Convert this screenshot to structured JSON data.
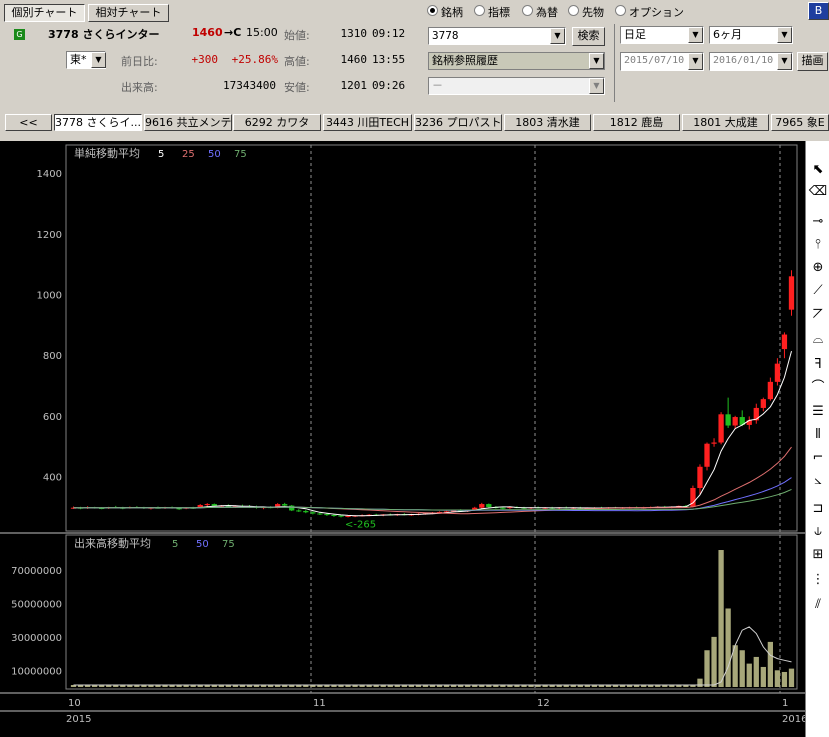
{
  "tabs_top": {
    "individual": "個別チャート",
    "relative": "相対チャート"
  },
  "stock": {
    "badge": "G",
    "code_name": "3778 さくらインター",
    "price": "1460",
    "arrow": "→C",
    "time": "15:00",
    "market": "東*",
    "change_label": "前日比:",
    "change": "+300",
    "change_pct": "+25.86%",
    "volume_label": "出来高:",
    "volume": "17343400"
  },
  "ohlc": {
    "open_label": "始値:",
    "open": "1310",
    "open_time": "09:12",
    "high_label": "高値:",
    "high": "1460",
    "high_time": "13:55",
    "low_label": "安値:",
    "low": "1201",
    "low_time": "09:26"
  },
  "radios": [
    "銘柄",
    "指標",
    "為替",
    "先物",
    "オプション"
  ],
  "radio_selected": "銘柄",
  "search": {
    "value": "3778",
    "button": "検索",
    "history": "銘柄参照履歴",
    "sub": "－"
  },
  "period": {
    "interval": "日足",
    "span": "6ヶ月",
    "from": "2015/07/10",
    "to": "2016/01/10",
    "draw": "描画"
  },
  "corner_btn": "B",
  "scroll_left": "<<",
  "stock_tabs": [
    "3778 さくらイ...",
    "9616 共立メンテ",
    "6292 カワタ",
    "3443 川田TECH",
    "3236 プロパスト",
    "1803 清水建",
    "1812 鹿島",
    "1801 大成建",
    "7965 象E"
  ],
  "chart_data": [
    {
      "type": "candlestick",
      "title": "単純移動平均",
      "ma_periods": [
        "5",
        "25",
        "50",
        "75"
      ],
      "ma_colors": [
        "#ffffff",
        "#e07070",
        "#7070ff",
        "#6fae6f"
      ],
      "y_ticks": [
        1400,
        1200,
        1000,
        800,
        600,
        400
      ],
      "ylim": [
        240,
        1460
      ],
      "annotation": "<-265",
      "annotation_value": 265,
      "candles": [
        [
          297,
          301,
          293,
          297
        ],
        [
          297,
          300,
          292,
          296
        ],
        [
          296,
          302,
          293,
          298
        ],
        [
          298,
          300,
          294,
          296
        ],
        [
          296,
          299,
          292,
          295
        ],
        [
          295,
          300,
          293,
          299
        ],
        [
          299,
          303,
          295,
          297
        ],
        [
          297,
          300,
          292,
          296
        ],
        [
          296,
          301,
          294,
          299
        ],
        [
          299,
          302,
          296,
          298
        ],
        [
          298,
          300,
          293,
          295
        ],
        [
          295,
          299,
          291,
          297
        ],
        [
          297,
          301,
          294,
          296
        ],
        [
          296,
          300,
          293,
          298
        ],
        [
          298,
          301,
          294,
          295
        ],
        [
          295,
          298,
          290,
          294
        ],
        [
          294,
          299,
          292,
          297
        ],
        [
          297,
          300,
          293,
          296
        ],
        [
          296,
          309,
          295,
          306
        ],
        [
          306,
          312,
          301,
          309
        ],
        [
          309,
          311,
          300,
          302
        ],
        [
          302,
          306,
          297,
          304
        ],
        [
          304,
          308,
          298,
          300
        ],
        [
          300,
          305,
          296,
          303
        ],
        [
          303,
          307,
          298,
          301
        ],
        [
          301,
          306,
          296,
          300
        ],
        [
          300,
          304,
          294,
          297
        ],
        [
          297,
          301,
          292,
          299
        ],
        [
          299,
          302,
          295,
          296
        ],
        [
          296,
          312,
          295,
          309
        ],
        [
          309,
          313,
          302,
          304
        ],
        [
          304,
          306,
          286,
          288
        ],
        [
          288,
          292,
          283,
          286
        ],
        [
          286,
          290,
          279,
          282
        ],
        [
          282,
          285,
          275,
          278
        ],
        [
          278,
          283,
          273,
          276
        ],
        [
          276,
          280,
          270,
          273
        ],
        [
          273,
          276,
          267,
          271
        ],
        [
          271,
          274,
          265,
          268
        ],
        [
          268,
          273,
          265,
          270
        ],
        [
          270,
          273,
          266,
          271
        ],
        [
          271,
          275,
          268,
          272
        ],
        [
          272,
          276,
          269,
          274
        ],
        [
          274,
          277,
          270,
          272
        ],
        [
          272,
          276,
          269,
          275
        ],
        [
          275,
          278,
          271,
          273
        ],
        [
          273,
          277,
          270,
          276
        ],
        [
          276,
          279,
          272,
          274
        ],
        [
          274,
          277,
          270,
          275
        ],
        [
          275,
          279,
          272,
          277
        ],
        [
          277,
          281,
          274,
          279
        ],
        [
          279,
          283,
          276,
          281
        ],
        [
          281,
          285,
          278,
          283
        ],
        [
          283,
          287,
          280,
          285
        ],
        [
          285,
          290,
          282,
          288
        ],
        [
          288,
          292,
          284,
          286
        ],
        [
          286,
          291,
          283,
          289
        ],
        [
          289,
          300,
          287,
          297
        ],
        [
          297,
          313,
          294,
          309
        ],
        [
          309,
          311,
          297,
          299
        ],
        [
          299,
          302,
          294,
          297
        ],
        [
          297,
          300,
          292,
          296
        ],
        [
          296,
          301,
          293,
          299
        ],
        [
          299,
          302,
          295,
          297
        ],
        [
          297,
          300,
          293,
          296
        ],
        [
          296,
          299,
          292,
          298
        ],
        [
          298,
          301,
          294,
          295
        ],
        [
          295,
          299,
          292,
          297
        ],
        [
          297,
          300,
          293,
          296
        ],
        [
          296,
          299,
          292,
          298
        ],
        [
          298,
          301,
          294,
          296
        ],
        [
          296,
          299,
          292,
          297
        ],
        [
          297,
          300,
          293,
          295
        ],
        [
          295,
          298,
          291,
          296
        ],
        [
          296,
          299,
          292,
          297
        ],
        [
          297,
          300,
          293,
          296
        ],
        [
          296,
          299,
          292,
          298
        ],
        [
          298,
          300,
          294,
          296
        ],
        [
          296,
          299,
          293,
          297
        ],
        [
          297,
          300,
          294,
          298
        ],
        [
          298,
          301,
          295,
          297
        ],
        [
          297,
          300,
          294,
          298
        ],
        [
          298,
          301,
          295,
          299
        ],
        [
          299,
          302,
          296,
          300
        ],
        [
          300,
          303,
          296,
          298
        ],
        [
          298,
          302,
          295,
          301
        ],
        [
          301,
          304,
          297,
          303
        ],
        [
          303,
          306,
          299,
          300
        ],
        [
          300,
          370,
          298,
          362
        ],
        [
          362,
          440,
          340,
          432
        ],
        [
          432,
          512,
          420,
          508
        ],
        [
          508,
          526,
          498,
          512
        ],
        [
          512,
          612,
          506,
          605
        ],
        [
          605,
          660,
          560,
          568
        ],
        [
          568,
          600,
          556,
          596
        ],
        [
          596,
          618,
          566,
          570
        ],
        [
          570,
          598,
          555,
          585
        ],
        [
          585,
          640,
          574,
          626
        ],
        [
          626,
          660,
          615,
          655
        ],
        [
          655,
          726,
          650,
          712
        ],
        [
          712,
          790,
          700,
          772
        ],
        [
          820,
          875,
          790,
          868
        ],
        [
          950,
          1080,
          930,
          1060
        ]
      ],
      "ma5_end": [
        800,
        580,
        560,
        530,
        490,
        440,
        380,
        340,
        310
      ],
      "ma25_end": [
        455,
        430,
        400,
        375,
        350,
        330,
        315,
        305
      ],
      "ma50_end": [
        385,
        360,
        340,
        325,
        312,
        304
      ],
      "ma75_end": [
        370,
        345,
        330,
        318,
        308,
        301
      ]
    },
    {
      "type": "bar",
      "title": "出来高移動平均",
      "ma_periods": [
        "5",
        "50",
        "75"
      ],
      "ma_colors": [
        "#6fae6f",
        "#7070ff",
        "#6fae6f"
      ],
      "y_ticks": [
        70000000,
        50000000,
        30000000,
        10000000
      ],
      "y_tick_labels": [
        "70000000",
        "50000000",
        "30000000",
        "10000000"
      ],
      "ylim": [
        0,
        85000000
      ],
      "volumes_tail": [
        1500000,
        5000000,
        22000000,
        30000000,
        82000000,
        47000000,
        25000000,
        22000000,
        14000000,
        18000000,
        12000000,
        27000000,
        10000000,
        9000000,
        11000000
      ],
      "volume_base": 1200000,
      "ma5_tail": [
        3000000,
        12000000,
        25000000,
        34000000,
        36000000,
        32000000,
        24000000,
        19000000,
        17000000,
        16000000,
        15000000
      ]
    }
  ],
  "x_axis": {
    "months": [
      "10",
      "11",
      "12",
      "1"
    ],
    "years": [
      "2015",
      "2016"
    ]
  },
  "tools": [
    "pointer-icon",
    "eraser-icon",
    "hline-icon",
    "vline-icon",
    "cross-icon",
    "trendline-icon",
    "fib-fan-icon",
    "fib-arc-icon",
    "fib-f-icon",
    "fib-arc2-icon",
    "fib-lines-icon",
    "fib-timezone-icon",
    "stairs-icon",
    "gann-icon",
    "bracket-icon",
    "cross-stairs-icon",
    "cycle-icon",
    "period-icon",
    "multi-line-icon"
  ],
  "tool_glyphs": [
    "⬉",
    "⌫",
    "⊸",
    "⫯",
    "⊕",
    "⟋",
    "⦢",
    "⌓",
    "ꟻ",
    "⌒",
    "☰",
    "⫴",
    "⌐",
    "⦣",
    "⊐",
    "⫝",
    "⊞",
    "⋮",
    "⫽"
  ]
}
